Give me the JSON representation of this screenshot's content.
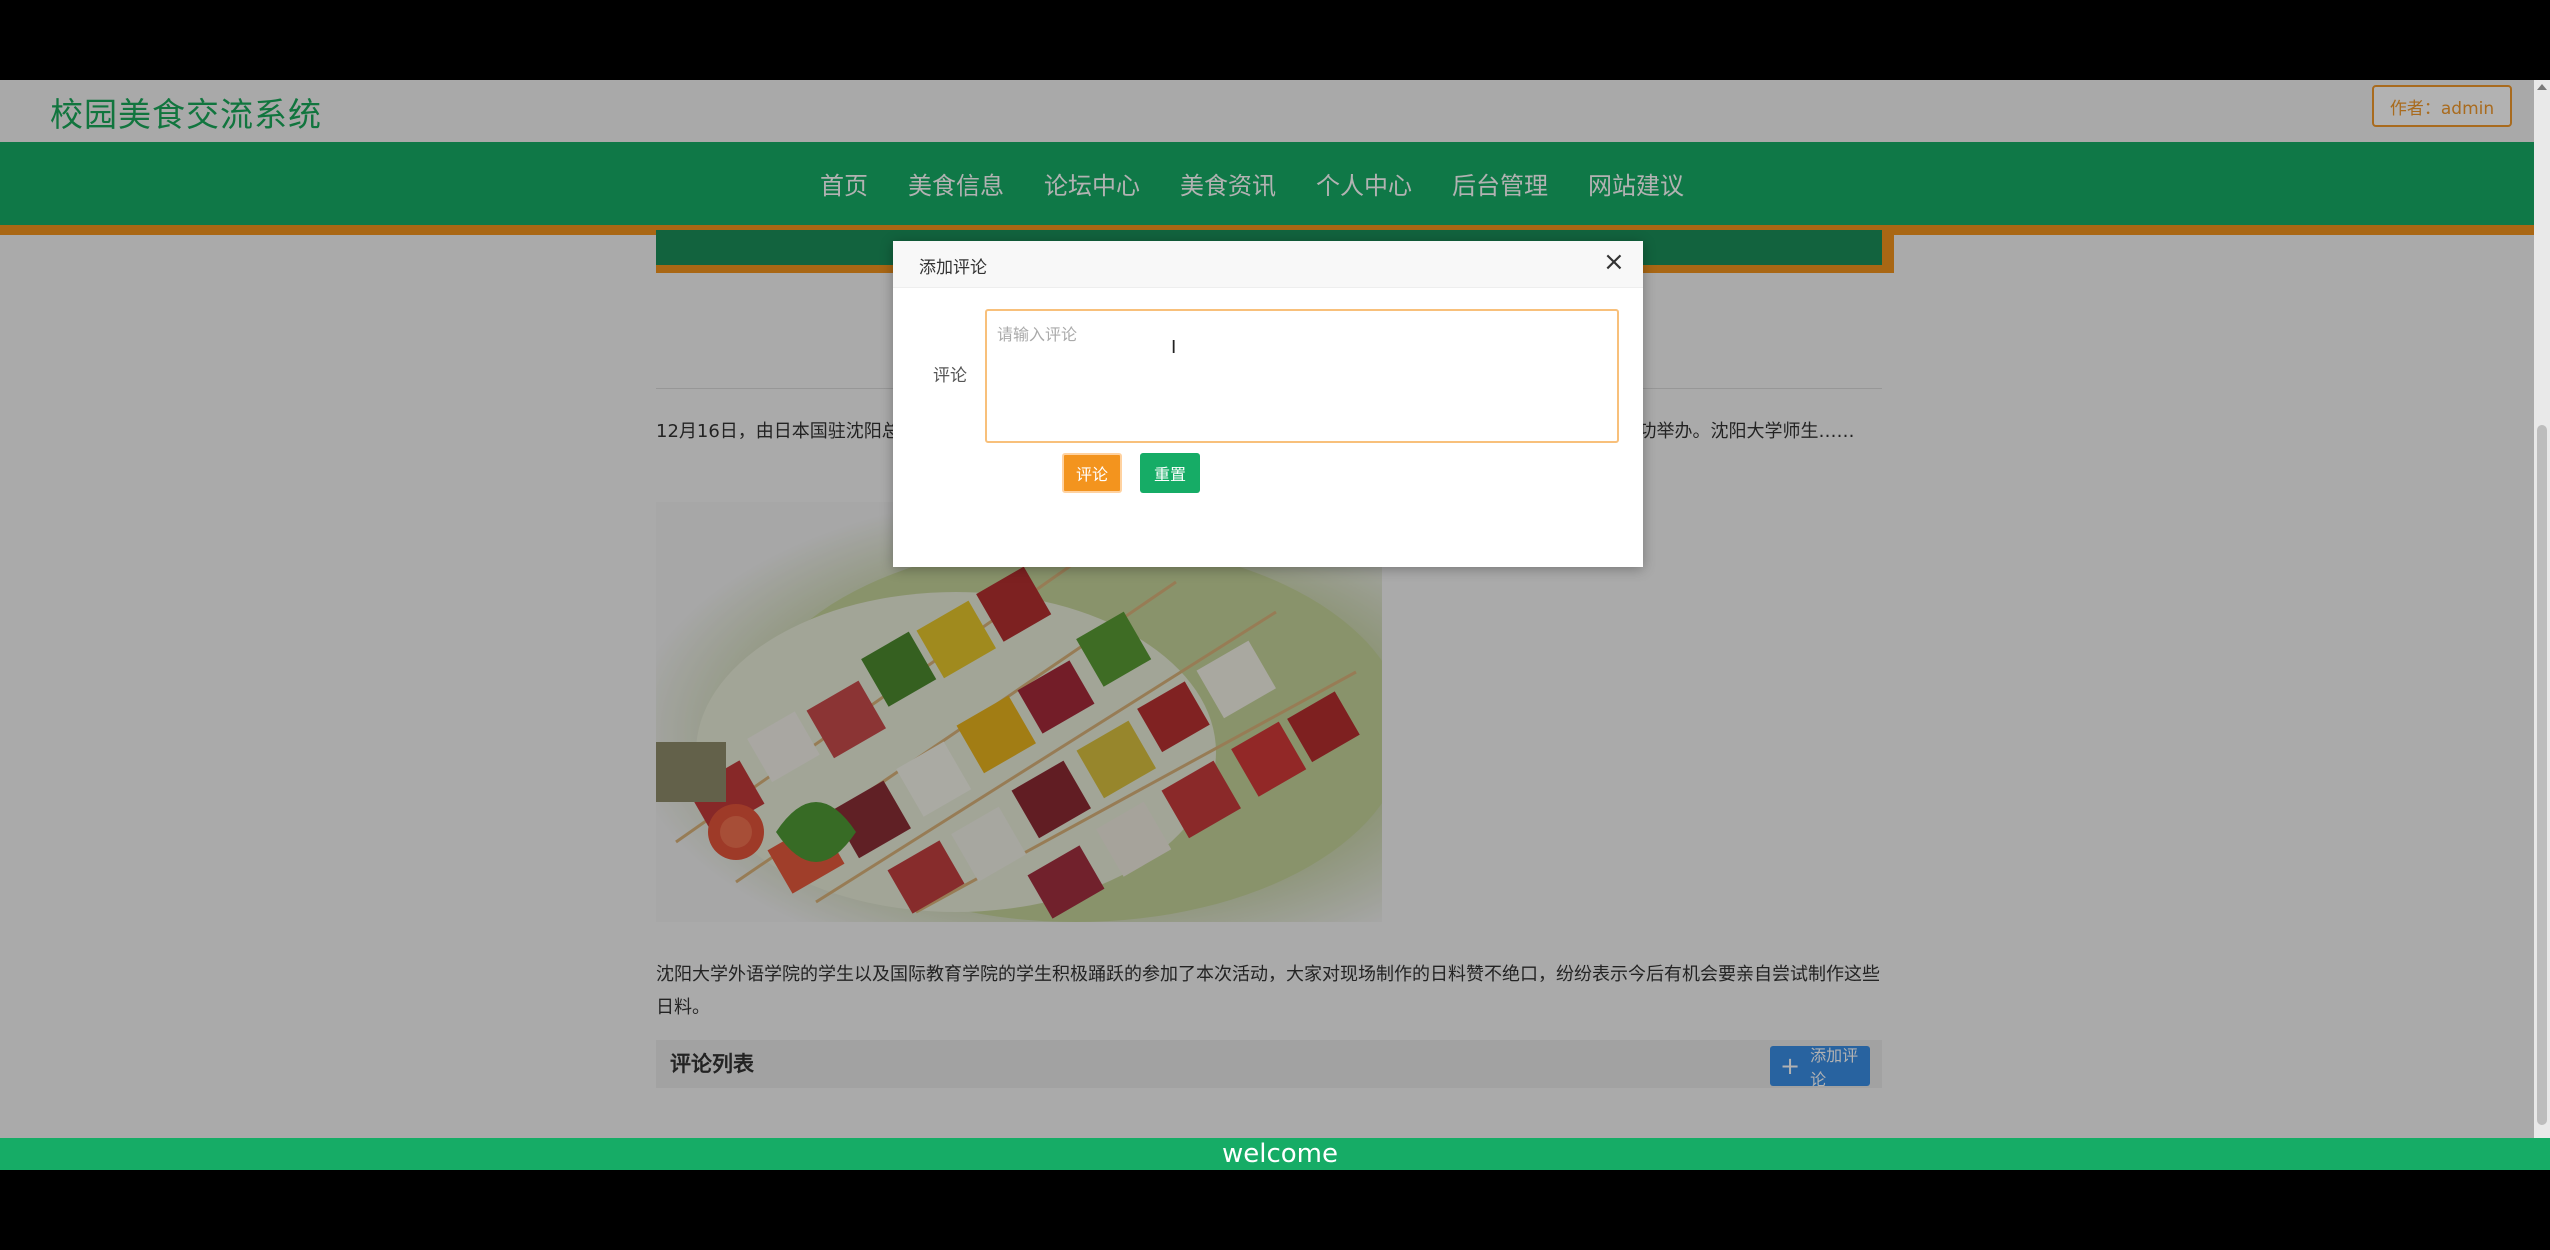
{
  "header": {
    "site_title": "校园美食交流系统",
    "author_label": "作者：admin"
  },
  "nav": {
    "items": [
      "首页",
      "美食信息",
      "论坛中心",
      "美食资讯",
      "个人中心",
      "后台管理",
      "网站建议"
    ]
  },
  "article": {
    "paragraph1": "12月16日，由日本国驻沈阳总领事馆主办、沈阳大学外国语学院和国际教育学院承办的“日本美食大讲堂”活动在沈阳大学成功举办。沈阳大学师生……",
    "paragraph2": "沈阳大学外语学院的学生以及国际教育学院的学生积极踊跃的参加了本次活动，大家对现场制作的日料赞不绝口，纷纷表示今后有机会要亲自尝试制作这些日料。"
  },
  "comments": {
    "list_title": "评论列表",
    "add_button": "添加评论"
  },
  "modal": {
    "title": "添加评论",
    "close_symbol": "×",
    "field_label": "评论",
    "placeholder": "请输入评论",
    "submit_label": "评论",
    "reset_label": "重置"
  },
  "footer": {
    "text": "welcome"
  },
  "colors": {
    "brand_green": "#16ac66",
    "accent_orange": "#f3941e",
    "link_blue": "#3a8ee6"
  }
}
